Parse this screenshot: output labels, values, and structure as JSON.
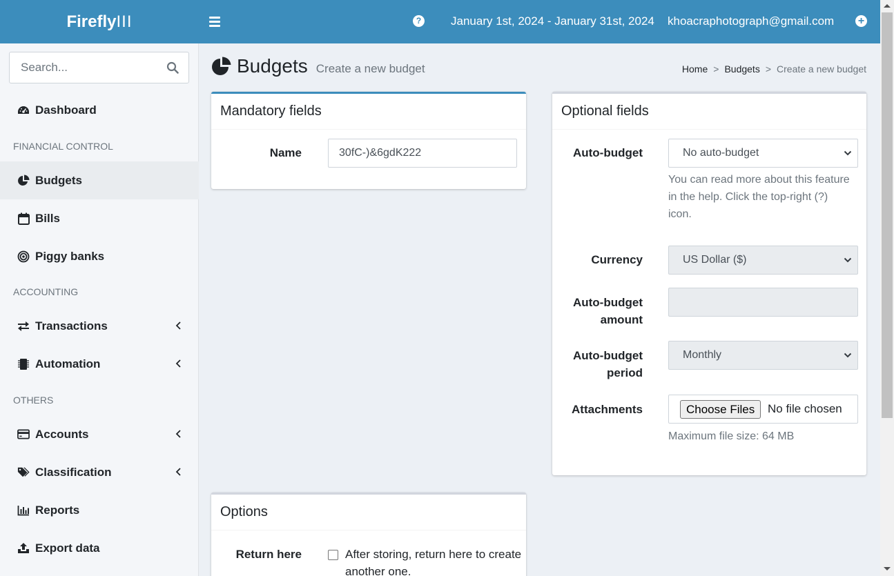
{
  "header": {
    "logo_bold": "Firefly",
    "logo_thin": "III",
    "date_range": "January 1st, 2024 - January 31st, 2024",
    "user_email": "khoacraphotograph@gmail.com"
  },
  "sidebar": {
    "search_placeholder": "Search...",
    "items": [
      {
        "label": "Dashboard",
        "icon": "dashboard-icon"
      },
      {
        "header": "FINANCIAL CONTROL"
      },
      {
        "label": "Budgets",
        "icon": "pie-chart-icon",
        "active": true
      },
      {
        "label": "Bills",
        "icon": "calendar-icon"
      },
      {
        "label": "Piggy banks",
        "icon": "bullseye-icon"
      },
      {
        "header": "ACCOUNTING"
      },
      {
        "label": "Transactions",
        "icon": "exchange-icon",
        "expandable": true
      },
      {
        "label": "Automation",
        "icon": "microchip-icon",
        "expandable": true
      },
      {
        "header": "OTHERS"
      },
      {
        "label": "Accounts",
        "icon": "credit-card-icon",
        "expandable": true
      },
      {
        "label": "Classification",
        "icon": "tags-icon",
        "expandable": true
      },
      {
        "label": "Reports",
        "icon": "bar-chart-icon"
      },
      {
        "label": "Export data",
        "icon": "upload-icon"
      }
    ]
  },
  "page": {
    "title": "Budgets",
    "subtitle": "Create a new budget",
    "breadcrumb": [
      "Home",
      "Budgets",
      "Create a new budget"
    ]
  },
  "mandatory": {
    "title": "Mandatory fields",
    "name_label": "Name",
    "name_value": "30fC-)&6gdK222"
  },
  "optional": {
    "title": "Optional fields",
    "auto_budget_label": "Auto-budget",
    "auto_budget_value": "No auto-budget",
    "auto_budget_help": [
      "You can read more about this feature",
      "in the help. Click the top-right (?)",
      "icon."
    ],
    "currency_label": "Currency",
    "currency_value": "US Dollar ($)",
    "amount_label_1": "Auto-budget",
    "amount_label_2": "amount",
    "amount_value": "",
    "period_label_1": "Auto-budget",
    "period_label_2": "period",
    "period_value": "Monthly",
    "attachments_label": "Attachments",
    "file_button": "Choose Files",
    "file_status": "No file chosen",
    "file_help": "Maximum file size: 64 MB"
  },
  "options": {
    "title": "Options",
    "return_label": "Return here",
    "return_text_1": "After storing, return here to create",
    "return_text_2": "another one."
  },
  "colors": {
    "header_bg": "#3c8dbc",
    "sidebar_bg": "#f4f6f9",
    "content_bg": "#ecf0f5"
  }
}
